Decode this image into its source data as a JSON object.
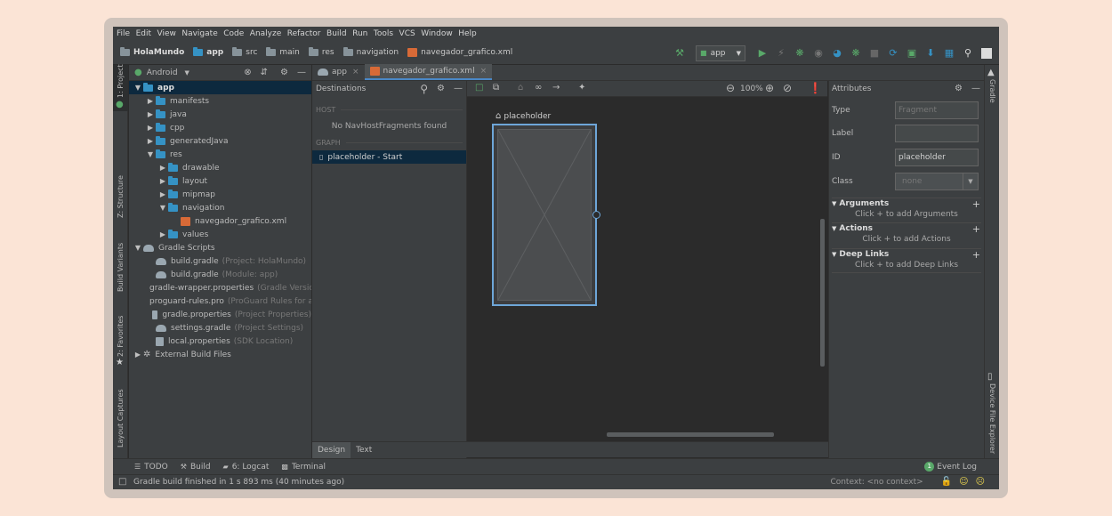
{
  "menu": [
    "File",
    "Edit",
    "View",
    "Navigate",
    "Code",
    "Analyze",
    "Refactor",
    "Build",
    "Run",
    "Tools",
    "VCS",
    "Window",
    "Help"
  ],
  "breadcrumbs": {
    "project": "HolaMundo",
    "module": "app",
    "src": "src",
    "main": "main",
    "res": "res",
    "navigation": "navigation",
    "file": "navegador_grafico.xml"
  },
  "run_config": "app",
  "left_tool_tabs": {
    "project": "1: Project",
    "structure": "Z: Structure",
    "build_variants": "Build Variants",
    "favorites": "2: Favorites",
    "layout_captures": "Layout Captures"
  },
  "right_tool_tabs": {
    "gradle": "Gradle",
    "device_file_explorer": "Device File Explorer"
  },
  "project_panel": {
    "view_selector": "Android",
    "tree": [
      {
        "label": "app",
        "level": 0,
        "expanded": true,
        "selected": true,
        "icon": "module-icon"
      },
      {
        "label": "manifests",
        "level": 1,
        "expanded": false,
        "icon": "folder-icon"
      },
      {
        "label": "java",
        "level": 1,
        "expanded": false,
        "icon": "folder-icon"
      },
      {
        "label": "cpp",
        "level": 1,
        "expanded": false,
        "icon": "folder-icon"
      },
      {
        "label": "generatedJava",
        "level": 1,
        "expanded": false,
        "icon": "folder-icon"
      },
      {
        "label": "res",
        "level": 1,
        "expanded": true,
        "icon": "folder-icon"
      },
      {
        "label": "drawable",
        "level": 2,
        "expanded": false,
        "icon": "folder-icon"
      },
      {
        "label": "layout",
        "level": 2,
        "expanded": false,
        "icon": "folder-icon"
      },
      {
        "label": "mipmap",
        "level": 2,
        "expanded": false,
        "icon": "folder-icon"
      },
      {
        "label": "navigation",
        "level": 2,
        "expanded": true,
        "icon": "folder-icon"
      },
      {
        "label": "navegador_grafico.xml",
        "level": 3,
        "leaf": true,
        "icon": "xml-file-icon"
      },
      {
        "label": "values",
        "level": 2,
        "expanded": false,
        "icon": "folder-icon"
      },
      {
        "label": "Gradle Scripts",
        "level": 0,
        "expanded": true,
        "icon": "gradle-icon"
      },
      {
        "label": "build.gradle",
        "hint": "(Project: HolaMundo)",
        "level": 1,
        "leaf": true,
        "icon": "gradle-icon"
      },
      {
        "label": "build.gradle",
        "hint": "(Module: app)",
        "level": 1,
        "leaf": true,
        "icon": "gradle-icon"
      },
      {
        "label": "gradle-wrapper.properties",
        "hint": "(Gradle Version",
        "level": 1,
        "leaf": true,
        "icon": "properties-icon"
      },
      {
        "label": "proguard-rules.pro",
        "hint": "(ProGuard Rules for ap",
        "level": 1,
        "leaf": true,
        "icon": "properties-icon"
      },
      {
        "label": "gradle.properties",
        "hint": "(Project Properties)",
        "level": 1,
        "leaf": true,
        "icon": "properties-icon"
      },
      {
        "label": "settings.gradle",
        "hint": "(Project Settings)",
        "level": 1,
        "leaf": true,
        "icon": "gradle-icon"
      },
      {
        "label": "local.properties",
        "hint": "(SDK Location)",
        "level": 1,
        "leaf": true,
        "icon": "properties-icon"
      },
      {
        "label": "External Build Files",
        "level": 0,
        "expanded": false,
        "icon": "external-build-icon"
      }
    ]
  },
  "editor_tabs": [
    {
      "label": "app",
      "active": false
    },
    {
      "label": "navegador_grafico.xml",
      "active": true
    }
  ],
  "destinations": {
    "title": "Destinations",
    "host_section": "HOST",
    "host_empty": "No NavHostFragments found",
    "graph_section": "GRAPH",
    "graph_item": "placeholder - Start"
  },
  "canvas": {
    "zoom": "100%",
    "placeholder_label": "placeholder"
  },
  "design_tabs": {
    "design": "Design",
    "text": "Text"
  },
  "attributes": {
    "title": "Attributes",
    "type_label": "Type",
    "type_value": "Fragment",
    "label_label": "Label",
    "label_value": "",
    "id_label": "ID",
    "id_value": "placeholder",
    "class_label": "Class",
    "class_value": "none",
    "arguments": {
      "title": "Arguments",
      "hint": "Click + to add Arguments"
    },
    "actions": {
      "title": "Actions",
      "hint": "Click + to add Actions"
    },
    "deep_links": {
      "title": "Deep Links",
      "hint": "Click + to add Deep Links"
    }
  },
  "bottom_tabs": {
    "todo": "TODO",
    "build": "Build",
    "logcat": "6: Logcat",
    "terminal": "Terminal",
    "event_log": "Event Log",
    "event_log_count": "1"
  },
  "status": {
    "message": "Gradle build finished in 1 s 893 ms (40 minutes ago)",
    "context": "Context: <no context>"
  },
  "colors": {
    "accent_blue": "#4a88c7",
    "run_green": "#59a869",
    "selection": "#0d293e",
    "xml_orange": "#d86a37"
  }
}
